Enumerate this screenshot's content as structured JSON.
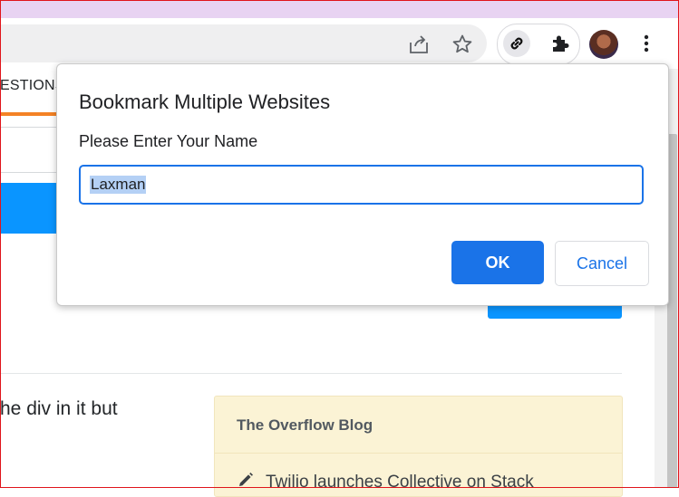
{
  "page": {
    "nav_tab_label": "ESTIONS",
    "snippet_text": "he div in it but",
    "blog": {
      "title": "The Overflow Blog",
      "item_label": "Twilio launches Collective on Stack"
    }
  },
  "dialog": {
    "title": "Bookmark Multiple Websites",
    "message": "Please Enter Your Name",
    "input_value": "Laxman",
    "ok_label": "OK",
    "cancel_label": "Cancel"
  },
  "toolbar": {
    "icons": [
      "share-icon",
      "star-icon",
      "link-extension-icon",
      "puzzle-icon",
      "avatar",
      "menu-icon"
    ]
  },
  "colors": {
    "accent": "#1a73e8",
    "so_blue": "#0a95ff",
    "so_orange": "#f48225",
    "blog_bg": "#fbf3d5",
    "window_frame": "#e8d3f2"
  }
}
